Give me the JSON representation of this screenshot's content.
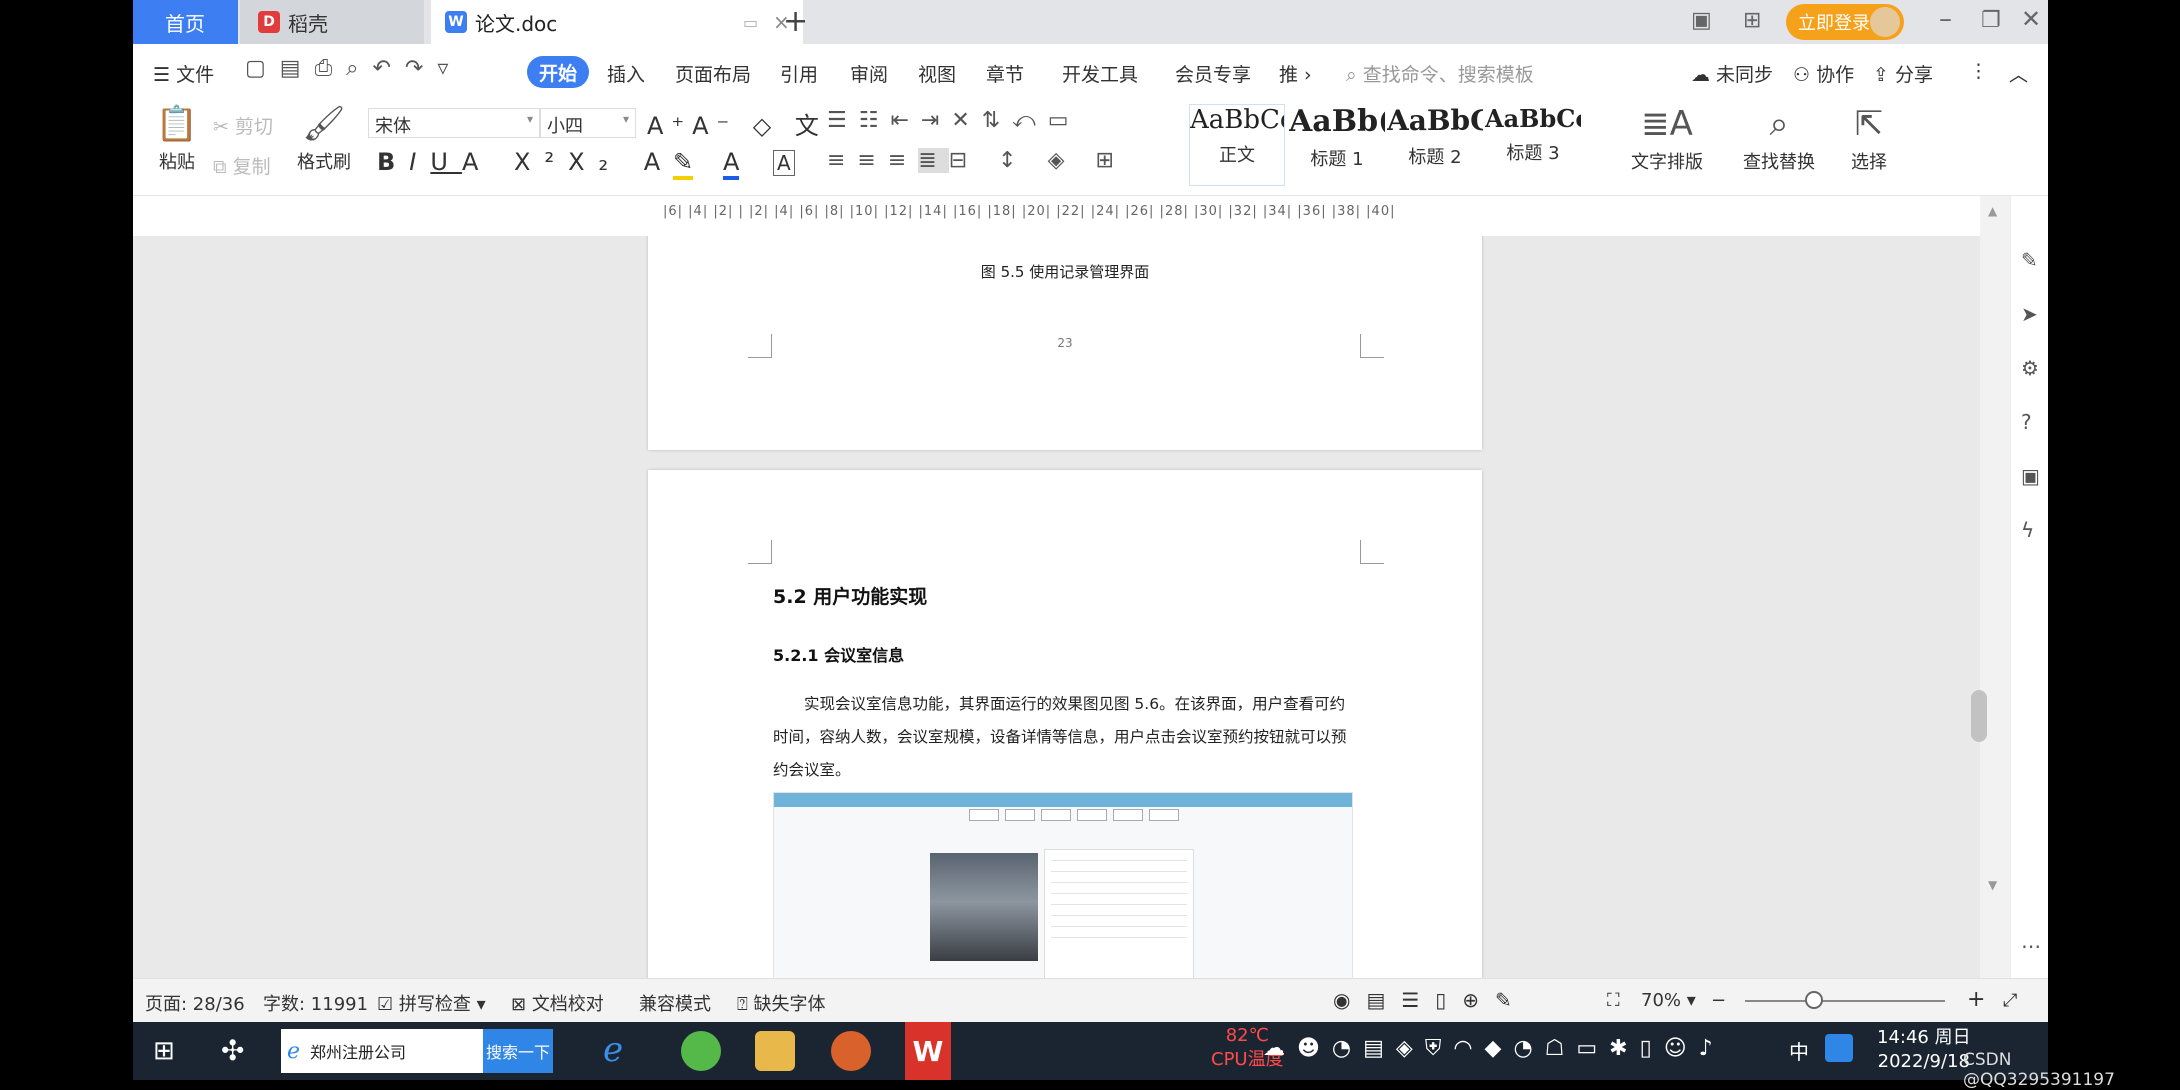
{
  "tabs": {
    "home": "首页",
    "daoke": "稻壳",
    "doc": "论文.doc",
    "login": "立即登录"
  },
  "menu": {
    "file": "文件",
    "items": [
      "开始",
      "插入",
      "页面布局",
      "引用",
      "审阅",
      "视图",
      "章节",
      "开发工具",
      "会员专享",
      "推"
    ],
    "search_placeholder": "查找命令、搜索模板",
    "sync": "未同步",
    "collab": "协作",
    "share": "分享"
  },
  "ribbon": {
    "paste": "粘贴",
    "cut": "剪切",
    "copy": "复制",
    "format_painter": "格式刷",
    "font": "宋体",
    "size": "小四",
    "styles": [
      {
        "preview": "AaBbCcI",
        "name": "正文"
      },
      {
        "preview": "AaBb(",
        "name": "标题 1"
      },
      {
        "preview": "AaBbC",
        "name": "标题 2"
      },
      {
        "preview": "AaBbCcl",
        "name": "标题 3"
      }
    ],
    "text_layout": "文字排版",
    "find_replace": "查找替换",
    "select": "选择"
  },
  "ruler": "|6| |4| |2| | |2| |4| |6| |8| |10| |12| |14| |16| |18| |20| |22| |24| |26| |28| |30| |32| |34| |36| |38| |40|",
  "document": {
    "prev_caption": "图 5.5  使用记录管理界面",
    "page_number": "23",
    "heading2": "5.2  用户功能实现",
    "heading3": "5.2.1  会议室信息",
    "paragraph": "实现会议室信息功能，其界面运行的效果图见图 5.6。在该界面，用户查看可约时间，容纳人数，会议室规模，设备详情等信息，用户点击会议室预约按钮就可以预约会议室。"
  },
  "status": {
    "page": "页面: 28/36",
    "words": "字数: 11991",
    "spell": "拼写检查",
    "proof": "文档校对",
    "compat": "兼容模式",
    "missing_font": "缺失字体",
    "zoom": "70%"
  },
  "taskbar": {
    "search_text": "郑州注册公司",
    "search_btn": "搜索一下",
    "temp": "82℃",
    "temp_label": "CPU温度",
    "ime": "中",
    "time": "14:46 周日",
    "date": "2022/9/18",
    "watermark": "CSDN @QQ3295391197"
  }
}
